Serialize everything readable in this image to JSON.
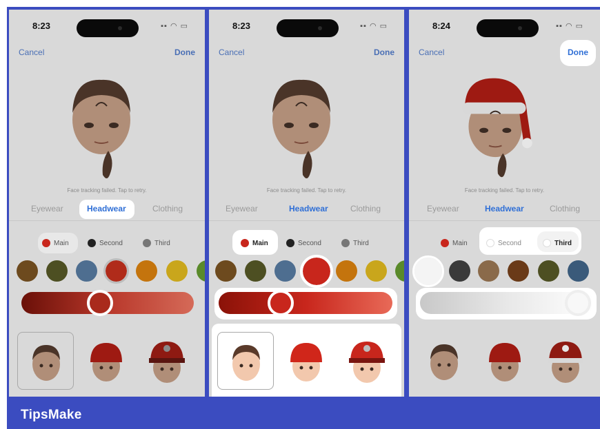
{
  "brand": "TipsMake",
  "colors": {
    "frame": "#3b4cc0",
    "accent": "#2f6fd6",
    "red": "#c8261c"
  },
  "panels": [
    {
      "time": "8:23",
      "cancel": "Cancel",
      "done": "Done",
      "hint": "Face tracking failed. Tap to retry.",
      "tabs": [
        "Eyewear",
        "Headwear",
        "Clothing"
      ],
      "active_tab": "Headwear",
      "options": [
        "Main",
        "Second",
        "Third"
      ],
      "selected_option": "Main",
      "slider_level": 0.45,
      "choices": [
        "none",
        "beanie",
        "cap"
      ]
    },
    {
      "time": "8:23",
      "cancel": "Cancel",
      "done": "Done",
      "hint": "Face tracking failed. Tap to retry.",
      "tabs": [
        "Eyewear",
        "Headwear",
        "Clothing"
      ],
      "active_tab": "Headwear",
      "options": [
        "Main",
        "Second",
        "Third"
      ],
      "selected_option": "Main",
      "slider_level": 0.33,
      "choices": [
        "none",
        "beanie",
        "cap"
      ]
    },
    {
      "time": "8:24",
      "cancel": "Cancel",
      "done": "Done",
      "hint": "Face tracking failed. Tap to retry.",
      "tabs": [
        "Eyewear",
        "Headwear",
        "Clothing"
      ],
      "active_tab": "Headwear",
      "options": [
        "Main",
        "Second",
        "Third"
      ],
      "selected_option": "Third",
      "slider_level": 0.98,
      "choices": [
        "none",
        "beanie",
        "cap"
      ]
    }
  ]
}
